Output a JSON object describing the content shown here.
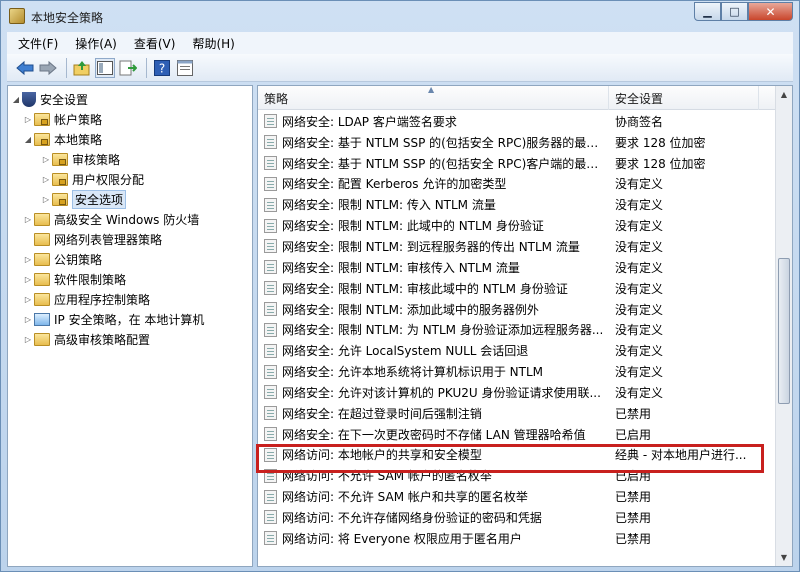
{
  "window": {
    "title": "本地安全策略"
  },
  "menu": [
    "文件(F)",
    "操作(A)",
    "查看(V)",
    "帮助(H)"
  ],
  "toolbar": [
    "back-icon",
    "forward-icon",
    "up-folder-icon",
    "show-tree-icon",
    "export-icon",
    "help-icon",
    "properties-icon"
  ],
  "tree": [
    {
      "label": "安全设置",
      "icon": "shield",
      "arrow": "expanded"
    },
    {
      "label": "帐户策略",
      "icon": "folder-lock",
      "arrow": "collapsed"
    },
    {
      "label": "本地策略",
      "icon": "folder-lock",
      "arrow": "expanded"
    },
    {
      "label": "审核策略",
      "icon": "folder-lock",
      "arrow": "collapsed"
    },
    {
      "label": "用户权限分配",
      "icon": "folder-lock",
      "arrow": "collapsed"
    },
    {
      "label": "安全选项",
      "icon": "folder-lock",
      "arrow": "collapsed",
      "selected": true
    },
    {
      "label": "高级安全 Windows 防火墙",
      "icon": "folder",
      "arrow": "collapsed"
    },
    {
      "label": "网络列表管理器策略",
      "icon": "folder",
      "arrow": "none"
    },
    {
      "label": "公钥策略",
      "icon": "folder",
      "arrow": "collapsed"
    },
    {
      "label": "软件限制策略",
      "icon": "folder",
      "arrow": "collapsed"
    },
    {
      "label": "应用程序控制策略",
      "icon": "folder",
      "arrow": "collapsed"
    },
    {
      "label": "IP 安全策略，在 本地计算机",
      "icon": "monitor",
      "arrow": "collapsed"
    },
    {
      "label": "高级审核策略配置",
      "icon": "folder",
      "arrow": "collapsed"
    }
  ],
  "list": {
    "headers": {
      "policy": "策略",
      "setting": "安全设置"
    },
    "rows": [
      {
        "policy": "网络安全: LDAP 客户端签名要求",
        "setting": "协商签名"
      },
      {
        "policy": "网络安全: 基于 NTLM SSP 的(包括安全 RPC)服务器的最小...",
        "setting": "要求 128 位加密"
      },
      {
        "policy": "网络安全: 基于 NTLM SSP 的(包括安全 RPC)客户端的最小...",
        "setting": "要求 128 位加密"
      },
      {
        "policy": "网络安全: 配置 Kerberos 允许的加密类型",
        "setting": "没有定义"
      },
      {
        "policy": "网络安全: 限制 NTLM: 传入 NTLM 流量",
        "setting": "没有定义"
      },
      {
        "policy": "网络安全: 限制 NTLM: 此域中的 NTLM 身份验证",
        "setting": "没有定义"
      },
      {
        "policy": "网络安全: 限制 NTLM: 到远程服务器的传出 NTLM 流量",
        "setting": "没有定义"
      },
      {
        "policy": "网络安全: 限制 NTLM: 审核传入 NTLM 流量",
        "setting": "没有定义"
      },
      {
        "policy": "网络安全: 限制 NTLM: 审核此域中的 NTLM 身份验证",
        "setting": "没有定义"
      },
      {
        "policy": "网络安全: 限制 NTLM: 添加此域中的服务器例外",
        "setting": "没有定义"
      },
      {
        "policy": "网络安全: 限制 NTLM: 为 NTLM 身份验证添加远程服务器...",
        "setting": "没有定义"
      },
      {
        "policy": "网络安全: 允许 LocalSystem NULL 会话回退",
        "setting": "没有定义"
      },
      {
        "policy": "网络安全: 允许本地系统将计算机标识用于 NTLM",
        "setting": "没有定义"
      },
      {
        "policy": "网络安全: 允许对该计算机的 PKU2U 身份验证请求使用联...",
        "setting": "没有定义"
      },
      {
        "policy": "网络安全: 在超过登录时间后强制注销",
        "setting": "已禁用"
      },
      {
        "policy": "网络安全: 在下一次更改密码时不存储 LAN 管理器哈希值",
        "setting": "已启用"
      },
      {
        "policy": "网络访问: 本地帐户的共享和安全模型",
        "setting": "经典 - 对本地用户进行..."
      },
      {
        "policy": "网络访问: 不允许 SAM 帐户的匿名枚举",
        "setting": "已启用"
      },
      {
        "policy": "网络访问: 不允许 SAM 帐户和共享的匿名枚举",
        "setting": "已禁用"
      },
      {
        "policy": "网络访问: 不允许存储网络身份验证的密码和凭据",
        "setting": "已禁用"
      },
      {
        "policy": "网络访问: 将 Everyone 权限应用于匿名用户",
        "setting": "已禁用"
      }
    ]
  }
}
